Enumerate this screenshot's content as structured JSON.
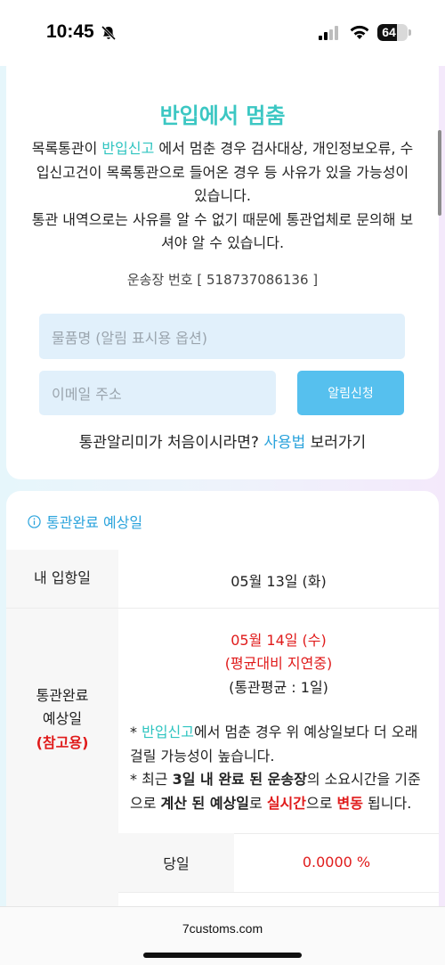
{
  "status_bar": {
    "time": "10:45",
    "battery": "64",
    "battery_level": 0.64
  },
  "notice": {
    "title": "반입에서 멈춤",
    "desc_part1": "목록통관이 ",
    "desc_highlight": "반입신고",
    "desc_part2": " 에서 멈춘 경우 검사대상, 개인정보오류, 수입신고건이 목록통관으로 들어온 경우 등 사유가 있을 가능성이 있습니다.",
    "desc_part3": "통관 내역으로는 사유를 알 수 없기 때문에 통관업체로 문의해 보셔야 알 수 있습니다.",
    "tracking_label": "운송장 번호 [ 518737086136 ]",
    "product_placeholder": "물품명 (알림 표시용 옵션)",
    "email_placeholder": "이메일 주소",
    "notify_button": "알림신청",
    "guide_prefix": "통관알리미가 처음이시라면? ",
    "guide_link": "사용법",
    "guide_suffix": " 보러가기"
  },
  "estimate": {
    "section_title": "통관완료 예상일",
    "arrival_label": "내 입항일",
    "arrival_value": "05월 13일 (화)",
    "estimate_label_1": "통관완료",
    "estimate_label_2": "예상일",
    "estimate_label_3": "(참고용)",
    "estimate_date": "05월 14일 (수)",
    "estimate_delay": "(평균대비 지연중)",
    "estimate_avg": "(통관평균 : 1일)",
    "note1_prefix": "* ",
    "note1_highlight": "반입신고",
    "note1_suffix": "에서 멈춘 경우 위 예상일보다 더 오래 걸릴 가능성이 높습니다.",
    "note2_a": "* 최근 ",
    "note2_b": "3일 내 완료 된 운송장",
    "note2_c": "의 소요시간을 기준으로 ",
    "note2_d": "계산 된 예상일",
    "note2_e": "로 ",
    "note2_f": "실시간",
    "note2_g": "으로 ",
    "note2_h": "변동",
    "note2_i": " 됩니다.",
    "sameday_label": "당일",
    "sameday_value": "0.0000 %"
  },
  "browser": {
    "url": "7customs.com"
  },
  "colors": {
    "teal": "#3cc7c3",
    "blue": "#2aa3dc",
    "button": "#56c0ee",
    "red": "#e01b1b",
    "input_bg": "#e1f0fb"
  }
}
